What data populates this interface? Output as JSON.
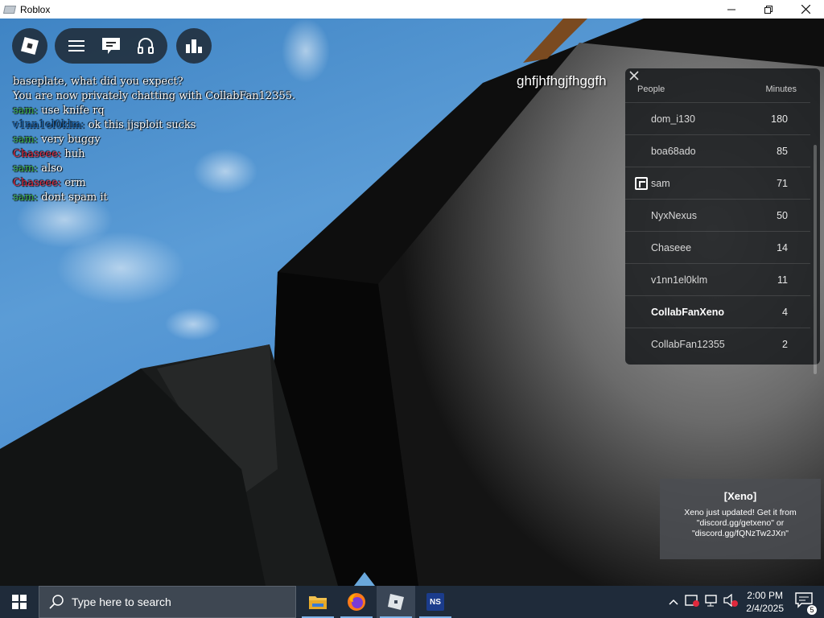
{
  "window": {
    "title": "Roblox",
    "controls": [
      "minimize",
      "restore",
      "close"
    ]
  },
  "chat": {
    "lines": [
      {
        "name": "",
        "name_color": "#ffffff",
        "text": "baseplate, what did you expect?"
      },
      {
        "name": "",
        "name_color": "#ffffff",
        "text": "You are now privately chatting with CollabFan12355."
      },
      {
        "name": "sam:",
        "name_color": "#3fae49",
        "text": "use knife rq"
      },
      {
        "name": "v1nn1el0klm:",
        "name_color": "#1f6fbf",
        "text": "ok this jjsploit sucks"
      },
      {
        "name": "sam:",
        "name_color": "#3fae49",
        "text": "very buggy"
      },
      {
        "name": "Chaseee:",
        "name_color": "#e0283c",
        "text": "huh"
      },
      {
        "name": "sam:",
        "name_color": "#3fae49",
        "text": "also"
      },
      {
        "name": "Chaseee:",
        "name_color": "#e0283c",
        "text": "erm"
      },
      {
        "name": "sam:",
        "name_color": "#3fae49",
        "text": "dont spam it"
      }
    ]
  },
  "overhead_name": "ghfjhfhgjfhggfh",
  "leaderboard": {
    "close_icon": "close-icon",
    "header": {
      "people": "People",
      "minutes": "Minutes"
    },
    "rows": [
      {
        "name": "dom_i130",
        "minutes": "180",
        "self": false,
        "badge": false
      },
      {
        "name": "boa68ado",
        "minutes": "85",
        "self": false,
        "badge": false
      },
      {
        "name": "sam",
        "minutes": "71",
        "self": false,
        "badge": true
      },
      {
        "name": "NyxNexus",
        "minutes": "50",
        "self": false,
        "badge": false
      },
      {
        "name": "Chaseee",
        "minutes": "14",
        "self": false,
        "badge": false
      },
      {
        "name": "v1nn1el0klm",
        "minutes": "11",
        "self": false,
        "badge": false
      },
      {
        "name": "CollabFanXeno",
        "minutes": "4",
        "self": true,
        "badge": false
      },
      {
        "name": "CollabFan12355",
        "minutes": "2",
        "self": false,
        "badge": false
      }
    ]
  },
  "notification": {
    "title": "[Xeno]",
    "body": "Xeno just updated! Get it from \"discord.gg/getxeno\" or \"discord.gg/fQNzTw2JXn\""
  },
  "taskbar": {
    "search_placeholder": "Type here to search",
    "apps": [
      "file-explorer",
      "firefox",
      "roblox",
      "ns"
    ],
    "ns_label": "NS",
    "time": "2:00 PM",
    "date": "2/4/2025",
    "notification_count": "5"
  },
  "colors": {
    "sky": "#4b8ed0",
    "leaderboard_bg": "#141619",
    "taskbar": "#1f2b3a"
  }
}
